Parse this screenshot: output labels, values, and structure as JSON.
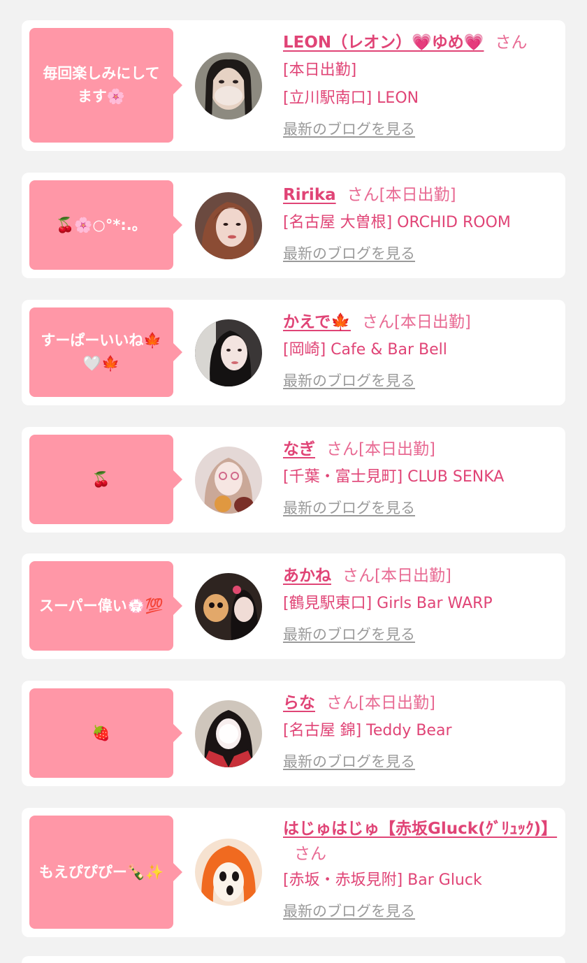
{
  "cards": [
    {
      "message": "毎回楽しみにしてます🌸",
      "name": "LEON（レオン）💗ゆめ💗",
      "suffix": "さん",
      "status": "",
      "status_line": "[本日出勤]",
      "shop": "[立川駅南口] LEON",
      "blog_link": "最新のブログを見る"
    },
    {
      "message": "🍒🌸○°*:.。",
      "name": "Ririka",
      "suffix": "さん",
      "status": "[本日出勤]",
      "status_line": "",
      "shop": "[名古屋 大曽根] ORCHID ROOM",
      "blog_link": "最新のブログを見る"
    },
    {
      "message": "すーぱーいいね🍁🤍🍁",
      "name": "かえで🍁",
      "suffix": "さん",
      "status": "[本日出勤]",
      "status_line": "",
      "shop": "[岡崎] Cafe & Bar Bell",
      "blog_link": "最新のブログを見る"
    },
    {
      "message": "🍒",
      "name": "なぎ",
      "suffix": "さん",
      "status": "[本日出勤]",
      "status_line": "",
      "shop": "[千葉・富士見町] CLUB SENKA",
      "blog_link": "最新のブログを見る"
    },
    {
      "message": "スーパー偉い💮💯",
      "name": "あかね",
      "suffix": "さん",
      "status": "[本日出勤]",
      "status_line": "",
      "shop": "[鶴見駅東口] Girls Bar WARP",
      "blog_link": "最新のブログを見る"
    },
    {
      "message": "🍓",
      "name": "らな",
      "suffix": "さん",
      "status": "[本日出勤]",
      "status_line": "",
      "shop": "[名古屋 錦] Teddy Bear",
      "blog_link": "最新のブログを見る"
    },
    {
      "message": "もえぴぴぴー🍾✨",
      "name": "はじゅはじゅ【赤坂Gluck(ｸﾞﾘｭｯｸ)】",
      "suffix": "さん",
      "status": "",
      "status_line": "",
      "shop": "[赤坂・赤坂見附] Bar Gluck",
      "blog_link": "最新のブログを見る"
    }
  ]
}
